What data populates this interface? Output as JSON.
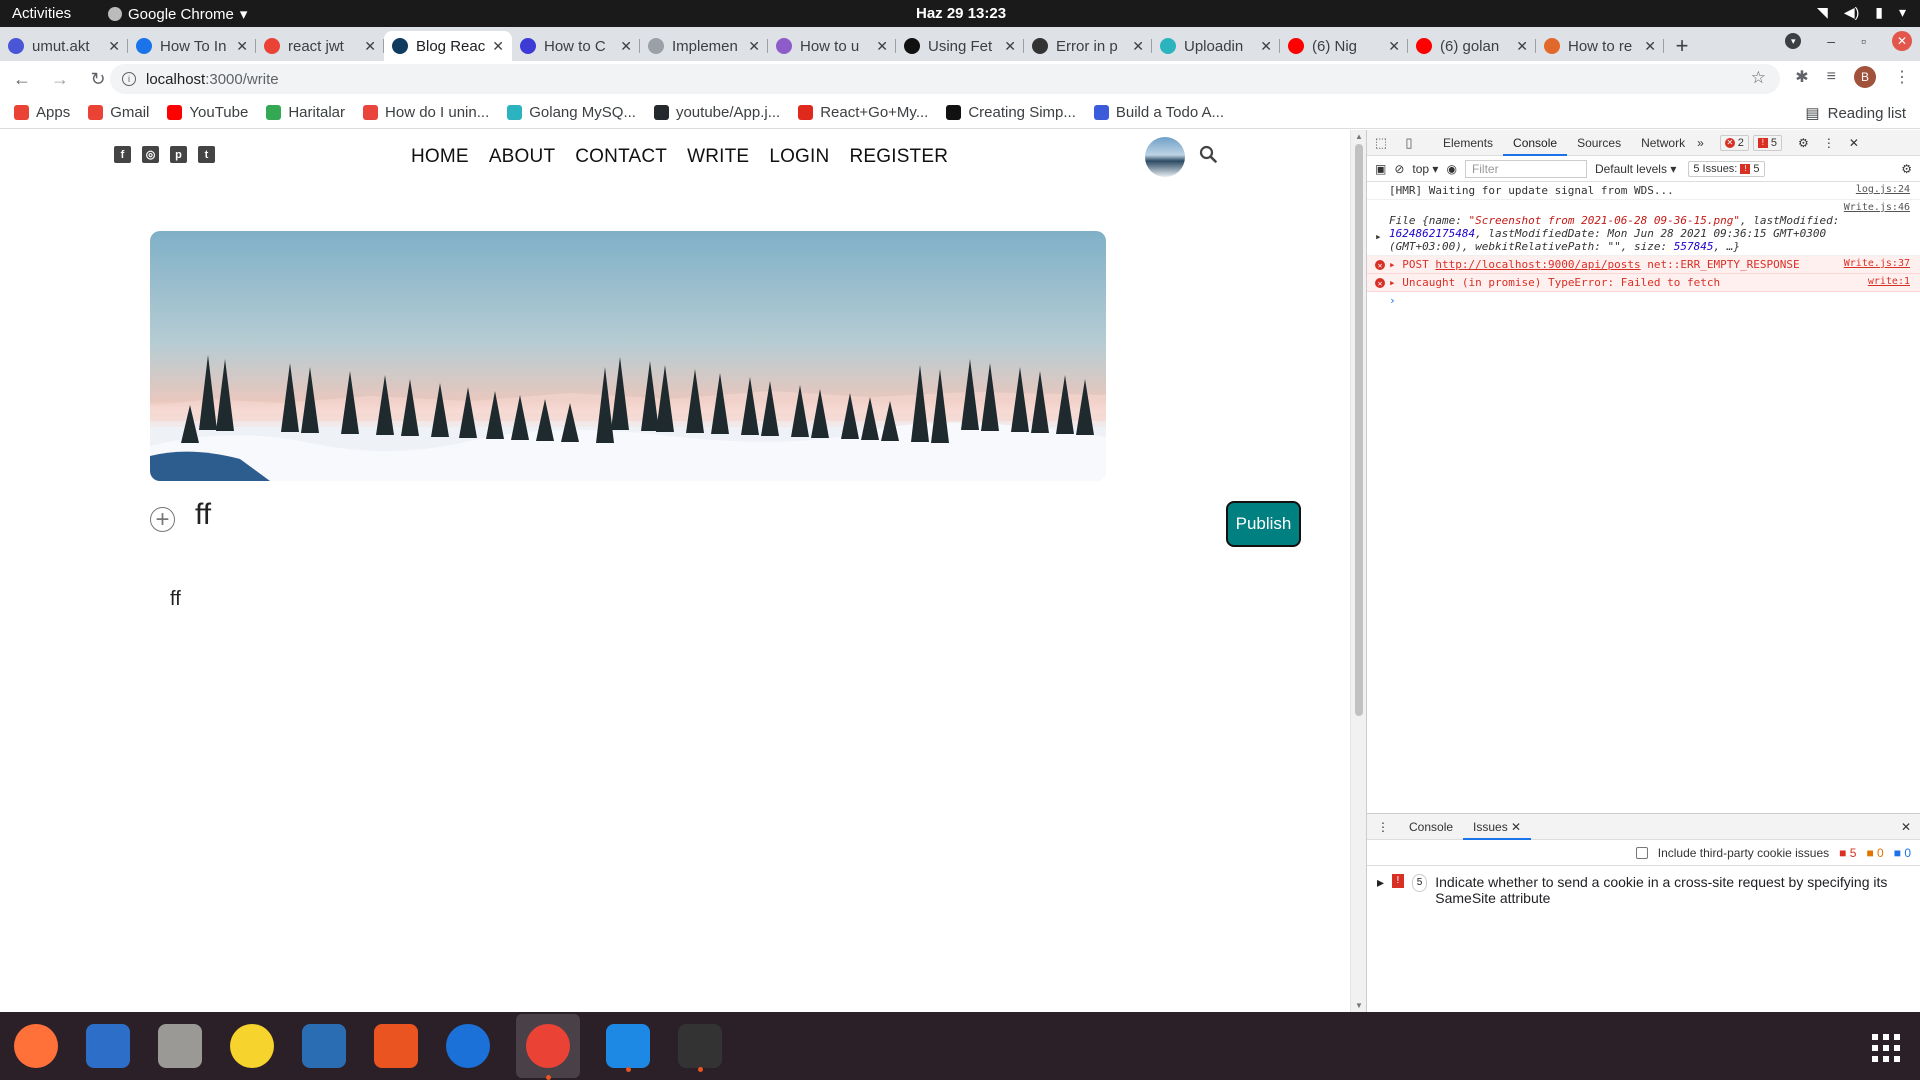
{
  "topbar": {
    "activities": "Activities",
    "app_name": "Google Chrome",
    "clock": "Haz 29  13:23"
  },
  "tabs": [
    {
      "label": "umut.akt",
      "color": "#4a56d6"
    },
    {
      "label": "How To In",
      "color": "#1a73e8"
    },
    {
      "label": "react jwt",
      "color": "#ea4335"
    },
    {
      "label": "Blog Reac",
      "color": "#0f3b5f",
      "active": true
    },
    {
      "label": "How to C",
      "color": "#3d3bd6"
    },
    {
      "label": "Implemen",
      "color": "#9aa0a6"
    },
    {
      "label": "How to u",
      "color": "#8e5cc9"
    },
    {
      "label": "Using Fet",
      "color": "#111111"
    },
    {
      "label": "Error in p",
      "color": "#333333"
    },
    {
      "label": "Uploadin",
      "color": "#2bb3c0"
    },
    {
      "label": "(6) Nig",
      "color": "#ff0000"
    },
    {
      "label": "(6) golan",
      "color": "#ff0000"
    },
    {
      "label": "How to re",
      "color": "#e2672a"
    }
  ],
  "toolbar": {
    "url_host": "localhost",
    "url_path": ":3000/write",
    "profile_initial": "B"
  },
  "bookmarks": [
    {
      "label": "Apps",
      "color": "#ea4335"
    },
    {
      "label": "Gmail",
      "color": "#ea4335"
    },
    {
      "label": "YouTube",
      "color": "#ff0000"
    },
    {
      "label": "Haritalar",
      "color": "#34a853"
    },
    {
      "label": "How do I unin...",
      "color": "#e8453c"
    },
    {
      "label": "Golang MySQ...",
      "color": "#2bb3c0"
    },
    {
      "label": "youtube/App.j...",
      "color": "#24292e"
    },
    {
      "label": "React+Go+My...",
      "color": "#e0291d"
    },
    {
      "label": "Creating Simp...",
      "color": "#111111"
    },
    {
      "label": "Build a Todo A...",
      "color": "#3b5bdb"
    }
  ],
  "reading_list": "Reading list",
  "page": {
    "social_icons": [
      "facebook-icon",
      "instagram-icon",
      "pinterest-icon",
      "twitter-icon"
    ],
    "nav": [
      "HOME",
      "ABOUT",
      "CONTACT",
      "WRITE",
      "LOGIN",
      "REGISTER"
    ],
    "title_value": "ff",
    "publish_label": "Publish",
    "body_value": "ff",
    "accent": "#008080"
  },
  "devtools": {
    "tabs": [
      "Elements",
      "Console",
      "Sources",
      "Network"
    ],
    "active_tab": "Console",
    "error_count": "2",
    "issue_count": "5",
    "context": "top",
    "filter_placeholder": "Filter",
    "levels": "Default levels",
    "issues_label": "5 Issues:",
    "issues_count": "5",
    "console": [
      {
        "text": "[HMR] Waiting for update signal from WDS...",
        "source": "log.js:24",
        "type": "log"
      },
      {
        "text_prefix": "File {name: ",
        "name_value": "\"Screenshot from 2021-06-28 09-36-15.png\"",
        "text_mid": ", lastModified: ",
        "lastmod_value": "1624862175484",
        "text_rest": ", lastModifiedDate: Mon Jun 28 2021 09:36:15 GMT+0300 (GMT+03:00), webkitRelativePath: \"\", size: ",
        "size_value": "557845",
        "text_end": ", …}",
        "source": "Write.js:46",
        "type": "log"
      },
      {
        "text_prefix": "POST ",
        "link": "http://localhost:9000/api/posts",
        "text_rest": " net::ERR_EMPTY_RESPONSE",
        "source": "Write.js:37",
        "type": "error"
      },
      {
        "text": "Uncaught (in promise) TypeError: Failed to fetch",
        "source": "write:1",
        "type": "error"
      }
    ],
    "drawer_tabs": [
      "Console",
      "Issues"
    ],
    "active_drawer_tab": "Issues",
    "third_party": "Include third-party cookie issues",
    "drawer_counts": {
      "errors": "5",
      "warnings": "0",
      "info": "0"
    },
    "issue": {
      "count": "5",
      "text": "Indicate whether to send a cookie in a cross-site request by specifying its SameSite attribute"
    }
  },
  "dock": [
    {
      "name": "firefox-icon",
      "color": "#ff7139"
    },
    {
      "name": "thunderbird-icon",
      "color": "#2d6fc8"
    },
    {
      "name": "files-icon",
      "color": "#9a9996"
    },
    {
      "name": "rhythmbox-icon",
      "color": "#f6d32d"
    },
    {
      "name": "writer-icon",
      "color": "#2a6db3"
    },
    {
      "name": "software-icon",
      "color": "#e95420"
    },
    {
      "name": "help-icon",
      "color": "#1c71d8"
    },
    {
      "name": "chrome-icon",
      "color": "#ea4335"
    },
    {
      "name": "vscode-icon",
      "color": "#1e88e5"
    },
    {
      "name": "terminal-icon",
      "color": "#333333"
    }
  ]
}
